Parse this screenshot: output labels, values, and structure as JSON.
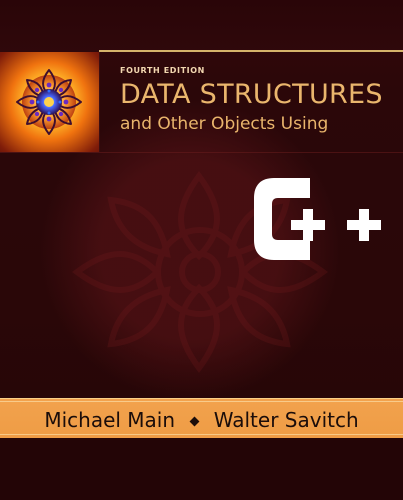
{
  "book": {
    "edition": "FOURTH EDITION",
    "title": "DATA STRUCTURES",
    "subtitle": "and Other Objects Using",
    "language": "C++",
    "authors": [
      "Michael Main",
      "Walter Savitch"
    ]
  },
  "icons": {
    "emblem": "mandala-icon",
    "separator": "diamond-icon"
  },
  "colors": {
    "background": "#2a0709",
    "title": "#eab66d",
    "accent_rule": "#d6b36a",
    "author_band": "#ee9c45",
    "cpp": "#ffffff"
  }
}
